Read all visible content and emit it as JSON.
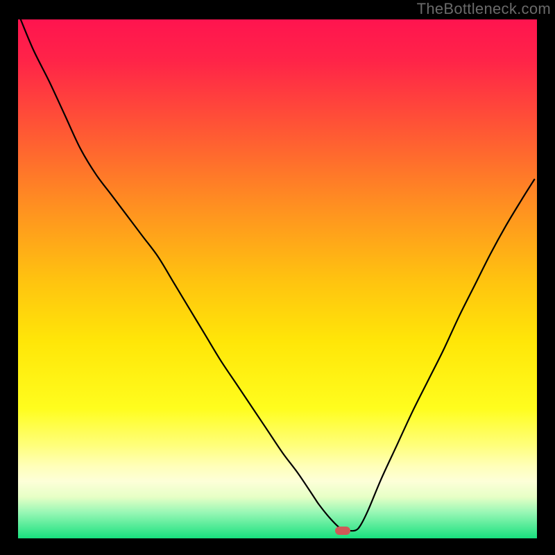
{
  "watermark": "TheBottleneck.com",
  "gradient": {
    "stops": [
      {
        "pct": 0,
        "color": "#ff144f"
      },
      {
        "pct": 8,
        "color": "#ff2448"
      },
      {
        "pct": 20,
        "color": "#ff5236"
      },
      {
        "pct": 35,
        "color": "#ff8c22"
      },
      {
        "pct": 50,
        "color": "#ffc210"
      },
      {
        "pct": 62,
        "color": "#ffe608"
      },
      {
        "pct": 75,
        "color": "#fffd1e"
      },
      {
        "pct": 82,
        "color": "#ffff7a"
      },
      {
        "pct": 86,
        "color": "#ffffb8"
      },
      {
        "pct": 89,
        "color": "#fdffd8"
      },
      {
        "pct": 92,
        "color": "#e7ffc6"
      },
      {
        "pct": 95,
        "color": "#98f7b5"
      },
      {
        "pct": 100,
        "color": "#18e07e"
      }
    ]
  },
  "marker": {
    "x_pct": 62.5,
    "y_pct": 99.0,
    "color": "#cf5a57"
  },
  "chart_data": {
    "type": "line",
    "title": "",
    "xlabel": "",
    "ylabel": "",
    "xlim": [
      0,
      100
    ],
    "ylim": [
      0,
      100
    ],
    "x": [
      0.5,
      3.0,
      6.0,
      9.0,
      12.0,
      15.0,
      18.0,
      21.0,
      24.0,
      27.0,
      30.0,
      33.0,
      36.0,
      39.0,
      42.0,
      45.0,
      48.0,
      51.0,
      54.0,
      57.0,
      58.0,
      60.0,
      62.0,
      63.5,
      65.0,
      66.0,
      67.5,
      70.0,
      73.0,
      76.0,
      79.0,
      82.0,
      85.0,
      88.0,
      91.0,
      94.0,
      97.0,
      99.5
    ],
    "values": [
      100,
      94,
      88,
      81.5,
      75,
      70,
      66,
      62,
      58,
      54,
      49,
      44,
      39,
      34,
      29.5,
      25,
      20.5,
      16,
      12,
      7.5,
      6,
      3.5,
      1.5,
      1.0,
      1.0,
      2,
      5,
      11,
      17.5,
      24,
      30,
      36,
      42.5,
      48.5,
      54.5,
      60,
      65,
      69
    ],
    "series_name": "bottleneck-curve",
    "grid": false,
    "legend": false,
    "background_gradient_direction": "vertical"
  }
}
